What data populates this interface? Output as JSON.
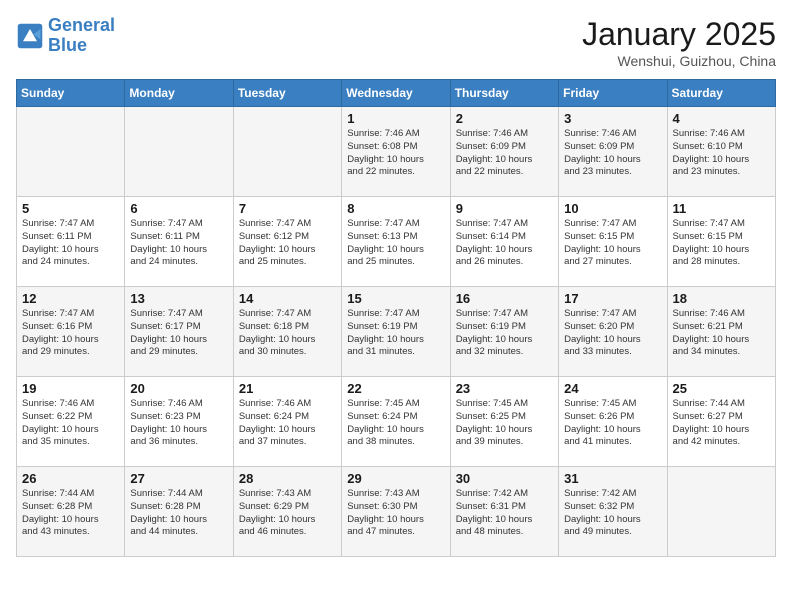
{
  "header": {
    "logo_line1": "General",
    "logo_line2": "Blue",
    "title": "January 2025",
    "subtitle": "Wenshui, Guizhou, China"
  },
  "days_of_week": [
    "Sunday",
    "Monday",
    "Tuesday",
    "Wednesday",
    "Thursday",
    "Friday",
    "Saturday"
  ],
  "weeks": [
    [
      {
        "day": "",
        "info": ""
      },
      {
        "day": "",
        "info": ""
      },
      {
        "day": "",
        "info": ""
      },
      {
        "day": "1",
        "info": "Sunrise: 7:46 AM\nSunset: 6:08 PM\nDaylight: 10 hours\nand 22 minutes."
      },
      {
        "day": "2",
        "info": "Sunrise: 7:46 AM\nSunset: 6:09 PM\nDaylight: 10 hours\nand 22 minutes."
      },
      {
        "day": "3",
        "info": "Sunrise: 7:46 AM\nSunset: 6:09 PM\nDaylight: 10 hours\nand 23 minutes."
      },
      {
        "day": "4",
        "info": "Sunrise: 7:46 AM\nSunset: 6:10 PM\nDaylight: 10 hours\nand 23 minutes."
      }
    ],
    [
      {
        "day": "5",
        "info": "Sunrise: 7:47 AM\nSunset: 6:11 PM\nDaylight: 10 hours\nand 24 minutes."
      },
      {
        "day": "6",
        "info": "Sunrise: 7:47 AM\nSunset: 6:11 PM\nDaylight: 10 hours\nand 24 minutes."
      },
      {
        "day": "7",
        "info": "Sunrise: 7:47 AM\nSunset: 6:12 PM\nDaylight: 10 hours\nand 25 minutes."
      },
      {
        "day": "8",
        "info": "Sunrise: 7:47 AM\nSunset: 6:13 PM\nDaylight: 10 hours\nand 25 minutes."
      },
      {
        "day": "9",
        "info": "Sunrise: 7:47 AM\nSunset: 6:14 PM\nDaylight: 10 hours\nand 26 minutes."
      },
      {
        "day": "10",
        "info": "Sunrise: 7:47 AM\nSunset: 6:15 PM\nDaylight: 10 hours\nand 27 minutes."
      },
      {
        "day": "11",
        "info": "Sunrise: 7:47 AM\nSunset: 6:15 PM\nDaylight: 10 hours\nand 28 minutes."
      }
    ],
    [
      {
        "day": "12",
        "info": "Sunrise: 7:47 AM\nSunset: 6:16 PM\nDaylight: 10 hours\nand 29 minutes."
      },
      {
        "day": "13",
        "info": "Sunrise: 7:47 AM\nSunset: 6:17 PM\nDaylight: 10 hours\nand 29 minutes."
      },
      {
        "day": "14",
        "info": "Sunrise: 7:47 AM\nSunset: 6:18 PM\nDaylight: 10 hours\nand 30 minutes."
      },
      {
        "day": "15",
        "info": "Sunrise: 7:47 AM\nSunset: 6:19 PM\nDaylight: 10 hours\nand 31 minutes."
      },
      {
        "day": "16",
        "info": "Sunrise: 7:47 AM\nSunset: 6:19 PM\nDaylight: 10 hours\nand 32 minutes."
      },
      {
        "day": "17",
        "info": "Sunrise: 7:47 AM\nSunset: 6:20 PM\nDaylight: 10 hours\nand 33 minutes."
      },
      {
        "day": "18",
        "info": "Sunrise: 7:46 AM\nSunset: 6:21 PM\nDaylight: 10 hours\nand 34 minutes."
      }
    ],
    [
      {
        "day": "19",
        "info": "Sunrise: 7:46 AM\nSunset: 6:22 PM\nDaylight: 10 hours\nand 35 minutes."
      },
      {
        "day": "20",
        "info": "Sunrise: 7:46 AM\nSunset: 6:23 PM\nDaylight: 10 hours\nand 36 minutes."
      },
      {
        "day": "21",
        "info": "Sunrise: 7:46 AM\nSunset: 6:24 PM\nDaylight: 10 hours\nand 37 minutes."
      },
      {
        "day": "22",
        "info": "Sunrise: 7:45 AM\nSunset: 6:24 PM\nDaylight: 10 hours\nand 38 minutes."
      },
      {
        "day": "23",
        "info": "Sunrise: 7:45 AM\nSunset: 6:25 PM\nDaylight: 10 hours\nand 39 minutes."
      },
      {
        "day": "24",
        "info": "Sunrise: 7:45 AM\nSunset: 6:26 PM\nDaylight: 10 hours\nand 41 minutes."
      },
      {
        "day": "25",
        "info": "Sunrise: 7:44 AM\nSunset: 6:27 PM\nDaylight: 10 hours\nand 42 minutes."
      }
    ],
    [
      {
        "day": "26",
        "info": "Sunrise: 7:44 AM\nSunset: 6:28 PM\nDaylight: 10 hours\nand 43 minutes."
      },
      {
        "day": "27",
        "info": "Sunrise: 7:44 AM\nSunset: 6:28 PM\nDaylight: 10 hours\nand 44 minutes."
      },
      {
        "day": "28",
        "info": "Sunrise: 7:43 AM\nSunset: 6:29 PM\nDaylight: 10 hours\nand 46 minutes."
      },
      {
        "day": "29",
        "info": "Sunrise: 7:43 AM\nSunset: 6:30 PM\nDaylight: 10 hours\nand 47 minutes."
      },
      {
        "day": "30",
        "info": "Sunrise: 7:42 AM\nSunset: 6:31 PM\nDaylight: 10 hours\nand 48 minutes."
      },
      {
        "day": "31",
        "info": "Sunrise: 7:42 AM\nSunset: 6:32 PM\nDaylight: 10 hours\nand 49 minutes."
      },
      {
        "day": "",
        "info": ""
      }
    ]
  ]
}
